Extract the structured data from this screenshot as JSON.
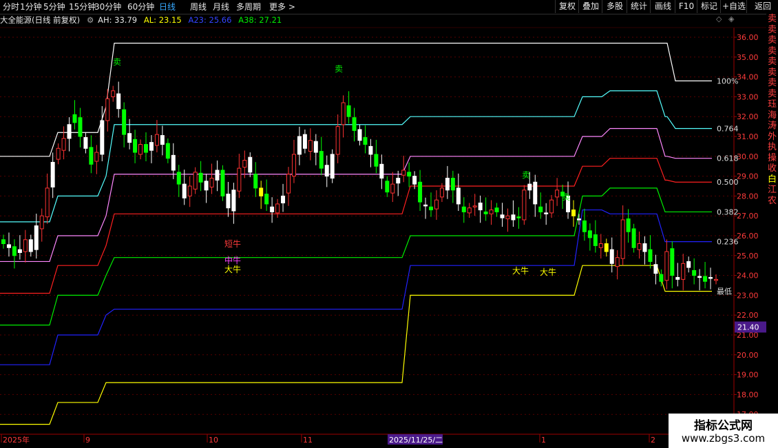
{
  "toolbar": {
    "periods": [
      "分时",
      "1分钟",
      "5分钟",
      "15分钟",
      "30分钟",
      "60分钟",
      "日线",
      "周线",
      "月线",
      "多周期",
      "更多 >"
    ],
    "active_period": "日线",
    "right_buttons": [
      "复权",
      "叠加",
      "多股",
      "统计",
      "画线",
      "F10",
      "标记",
      "+自选",
      "返回"
    ]
  },
  "info": {
    "title": "大全能源(日线 前复权)",
    "ah": "AH: 33.79",
    "al": "AL: 23.15",
    "a23": "A23: 25.66",
    "a38": "A38: 27.21"
  },
  "colors": {
    "up": "#ff3232",
    "down": "#00e0ff",
    "white_candle": "#ffffff",
    "green_candle": "#00ff00",
    "yellow_candle": "#ffff00",
    "level_100": "#ffffff",
    "level_764": "#55ffff",
    "level_618": "#ff88ff",
    "level_500": "#ff2020",
    "level_382": "#00ee00",
    "level_236": "#2222ff",
    "level_low": "#ffff00",
    "axis": "#a00000",
    "grid": "#5a0000"
  },
  "chart_data": {
    "type": "candlestick",
    "y_axis_ticks": [
      "36.00",
      "35.00",
      "34.00",
      "33.00",
      "32.00",
      "31.00",
      "30.00",
      "29.00",
      "28.00",
      "27.00",
      "26.00",
      "25.00",
      "24.00",
      "23.00",
      "22.00",
      "21.00",
      "20.00",
      "19.00",
      "18.00",
      "17.00"
    ],
    "ylim": [
      16.5,
      36.5
    ],
    "current_price_tag": "21.40",
    "x_axis_labels": [
      "2025年",
      "9",
      "10",
      "11",
      "2025/11/25/二",
      "1",
      "2"
    ],
    "level_labels": [
      "100%",
      "0.764",
      "0.618",
      "0.500",
      "0.382",
      "0.236",
      "最低"
    ],
    "signals": [
      "卖",
      "卖",
      "卖",
      "卖",
      "短牛",
      "中牛",
      "大牛",
      "大牛",
      "大牛"
    ],
    "right_strip_text": [
      "卖",
      "卖",
      "卖",
      "卖",
      "卖",
      "卖",
      "卖",
      "卖",
      "珏",
      "海",
      "涛",
      "外",
      "执",
      "操",
      "收",
      "白",
      "江",
      "农"
    ],
    "level_lines": [
      {
        "name": "100%",
        "values": [
          30.0,
          31.2,
          31.2,
          32.5,
          35.7,
          35.7,
          35.7,
          35.7,
          35.7,
          35.7,
          35.7,
          33.8
        ]
      },
      {
        "name": "0.764",
        "values": [
          26.7,
          28.0,
          28.0,
          29.0,
          31.6,
          31.6,
          31.6,
          32.0,
          33.0,
          33.3,
          32.0,
          31.4
        ]
      },
      {
        "name": "0.618",
        "values": [
          24.7,
          26.0,
          26.0,
          27.0,
          29.1,
          29.1,
          29.1,
          30.0,
          31.0,
          31.4,
          30.0,
          29.9
        ]
      },
      {
        "name": "0.500",
        "values": [
          23.1,
          24.5,
          24.5,
          25.5,
          27.1,
          27.1,
          27.1,
          28.5,
          29.5,
          29.9,
          28.8,
          28.7
        ]
      },
      {
        "name": "0.382",
        "values": [
          21.5,
          23.0,
          23.0,
          24.0,
          24.9,
          24.9,
          24.9,
          26.0,
          28.0,
          28.4,
          27.2,
          27.2
        ]
      },
      {
        "name": "0.236",
        "values": [
          19.5,
          21.0,
          21.0,
          22.0,
          22.3,
          22.3,
          22.3,
          24.5,
          27.3,
          27.1,
          25.7,
          25.7
        ]
      },
      {
        "name": "最低",
        "values": [
          16.5,
          17.6,
          17.6,
          18.6,
          18.6,
          18.6,
          18.6,
          23.0,
          24.5,
          24.5,
          23.2,
          23.2
        ]
      }
    ]
  },
  "watermark": {
    "title": "指标公式网",
    "url": "www.zbgs3.com"
  }
}
